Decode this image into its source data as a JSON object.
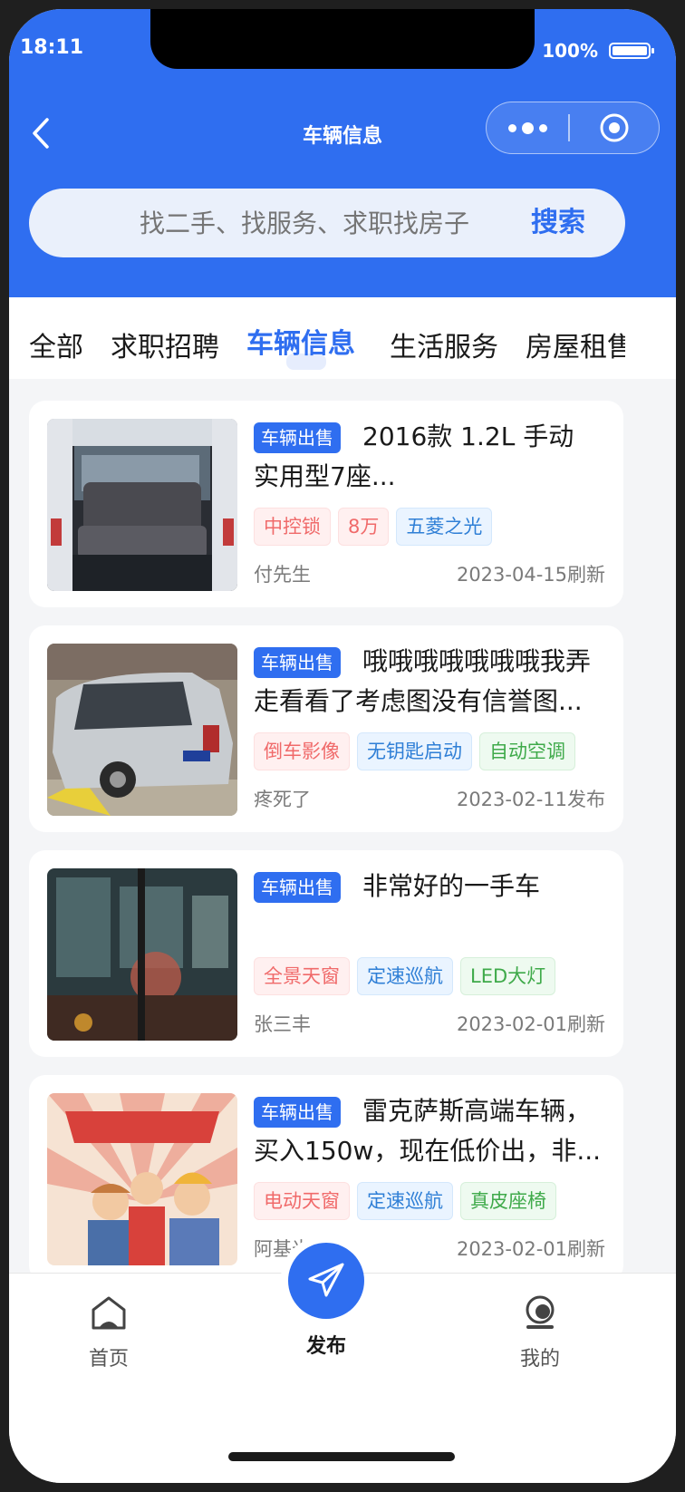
{
  "status": {
    "time": "18:11",
    "battery": "100%"
  },
  "nav": {
    "title": "车辆信息"
  },
  "search": {
    "placeholder": "找二手、找服务、求职找房子",
    "button": "搜索"
  },
  "tabs": [
    {
      "label": "全部"
    },
    {
      "label": "求职招聘"
    },
    {
      "label": "车辆信息"
    },
    {
      "label": "生活服务"
    },
    {
      "label": "房屋租售"
    }
  ],
  "active_tab": "车辆信息",
  "listings": [
    {
      "category": "车辆出售",
      "title": "2016款 1.2L 手动 实用型7座...",
      "tags": [
        {
          "text": "中控锁",
          "color": "red"
        },
        {
          "text": "8万",
          "color": "red"
        },
        {
          "text": "五菱之光",
          "color": "blue"
        }
      ],
      "author": "付先生",
      "date": "2023-04-15刷新"
    },
    {
      "category": "车辆出售",
      "title": "哦哦哦哦哦哦哦我弄走看看了考虑图没有信誉图...",
      "tags": [
        {
          "text": "倒车影像",
          "color": "red"
        },
        {
          "text": "无钥匙启动",
          "color": "blue"
        },
        {
          "text": "自动空调",
          "color": "green"
        }
      ],
      "author": "疼死了",
      "date": "2023-02-11发布"
    },
    {
      "category": "车辆出售",
      "title": "非常好的一手车",
      "tags": [
        {
          "text": "全景天窗",
          "color": "red"
        },
        {
          "text": "定速巡航",
          "color": "blue"
        },
        {
          "text": "LED大灯",
          "color": "green"
        }
      ],
      "author": "张三丰",
      "date": "2023-02-01刷新"
    },
    {
      "category": "车辆出售",
      "title": "雷克萨斯高端车辆，买入150w，现在低价出，非...",
      "tags": [
        {
          "text": "电动天窗",
          "color": "red"
        },
        {
          "text": "定速巡航",
          "color": "blue"
        },
        {
          "text": "真皮座椅",
          "color": "green"
        }
      ],
      "author": "阿基米德",
      "date": "2023-02-01刷新"
    }
  ],
  "tabbar": {
    "home": "首页",
    "publish": "发布",
    "mine": "我的"
  },
  "colors": {
    "primary": "#2f6ef0"
  },
  "icons": {
    "back": "chevron-left-icon",
    "more": "more-dots-icon",
    "close": "target-icon",
    "publish": "paper-plane-icon",
    "home": "home-icon",
    "mine": "user-icon"
  }
}
